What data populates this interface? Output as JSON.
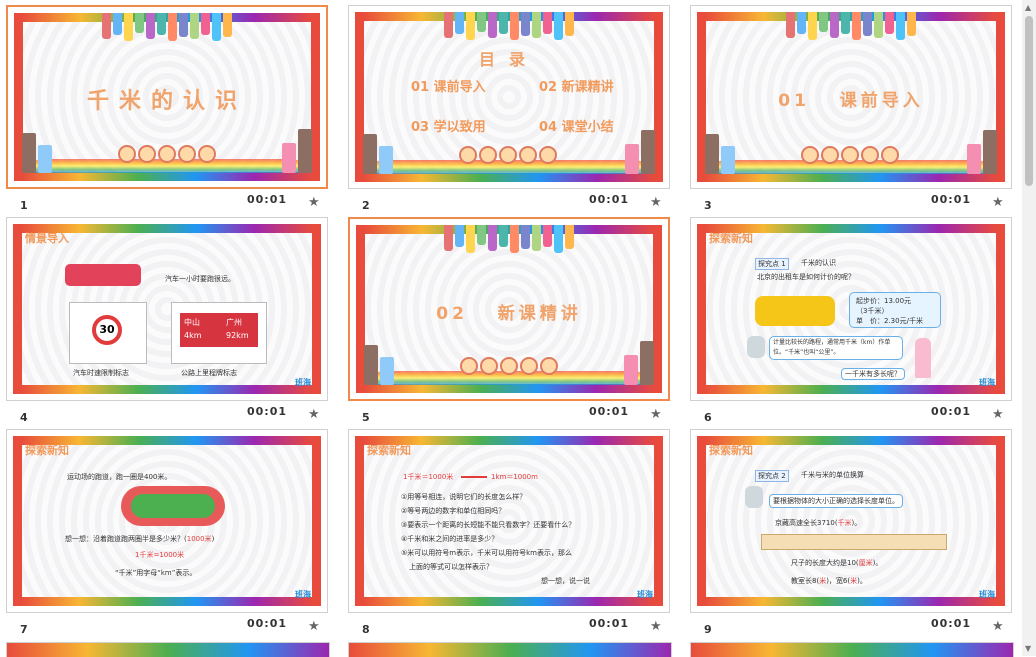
{
  "slides": [
    {
      "num": "1",
      "time": "00:01",
      "title": "千米的认识"
    },
    {
      "num": "2",
      "time": "00:01",
      "title": "目录",
      "items": [
        "01 课前导入",
        "02 新课精讲",
        "03 学以致用",
        "04 课堂小结"
      ]
    },
    {
      "num": "3",
      "time": "00:01",
      "title": "01   课前导入"
    },
    {
      "num": "4",
      "time": "00:01",
      "label": "情景导入",
      "text1": "汽车一小时要跑很远。",
      "sign1": "30",
      "sign2a": "中山",
      "sign2b": "4km",
      "sign2c": "广州",
      "sign2d": "92km",
      "cap1": "汽车时速限制标志",
      "cap2": "公路上里程牌标志",
      "logo": "班海"
    },
    {
      "num": "5",
      "time": "00:01",
      "title": "02   新课精讲"
    },
    {
      "num": "6",
      "time": "00:01",
      "label": "探索新知",
      "tag": "探究点 1",
      "tagtext": "千米的认识",
      "q": "北京的出租车是如何计价的呢？",
      "price1": "起步价：13.00元",
      "price2": "（3千米）",
      "price3": "单　价：2.30元/千米",
      "bubble": "计量比较长的路程，通常用千米（km）作单位。“千米”也叫“公里”。",
      "ask": "一千米有多长呢？",
      "logo": "班海"
    },
    {
      "num": "7",
      "time": "00:01",
      "label": "探索新知",
      "t1": "运动场的跑道，跑一圈是400米。",
      "t2": "想一想：沿着跑道跑两圈半是多少米？(",
      "t2a": "1000米",
      "t2b": ")",
      "t3": "1千米=1000米",
      "t4": "“千米”用字母“km”表示。",
      "logo": "班海"
    },
    {
      "num": "8",
      "time": "00:01",
      "label": "探索新知",
      "eq1": "1千米＝1000米",
      "eq2": "1km＝1000m",
      "l1": "①用等号相连，说明它们的长度怎么样？",
      "l2": "②等号两边的数字和单位相同吗？",
      "l3": "③要表示一个距离的长短能不能只看数字？还要看什么？",
      "l4": "④千米和米之间的进率是多少？",
      "l5": "⑤米可以用符号m表示，千米可以用符号km表示，那么",
      "l6": "上面的等式可以怎样表示？",
      "l7": "想一想，说一说",
      "logo": "班海"
    },
    {
      "num": "9",
      "time": "00:01",
      "label": "探索新知",
      "tag": "探究点 2",
      "tagtext": "千米与米的单位换算",
      "bubble": "要根据物体的大小正确的选择长度单位。",
      "r1": "京藏高速全长3710(",
      "r1a": "千米",
      "r1b": ")。",
      "r2": "尺子的长度大约是10(",
      "r2a": "厘米",
      "r2b": ")。",
      "r3": "教室长8(",
      "r3a": "米",
      "r3b": ")，宽6(",
      "r3c": "米",
      "r3d": ")。",
      "logo": "班海"
    }
  ],
  "colors": {
    "accent": "#f08a4b",
    "title": "#f0a36a",
    "red": "#e23b3b"
  }
}
